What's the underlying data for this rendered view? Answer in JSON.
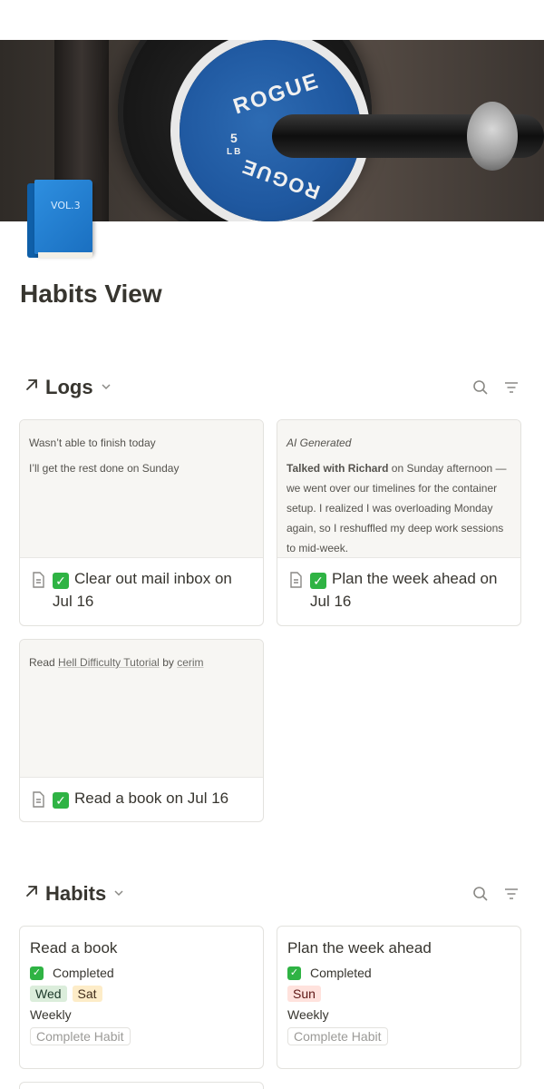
{
  "page": {
    "title": "Habits View"
  },
  "cover": {
    "plate_brand": "ROGUE",
    "plate_weight": "5",
    "plate_unit": "LB"
  },
  "icon": {
    "name": "blue-book-icon",
    "label": "VOL.3"
  },
  "logs": {
    "title": "Logs",
    "cards": [
      {
        "preview_lines": [
          "Wasn’t able to finish today",
          "I’ll get the rest done on Sunday"
        ],
        "label": "Clear out mail inbox on Jul 16"
      },
      {
        "preview_heading": "AI Generated",
        "preview_bold": "Talked with Richard",
        "preview_text": " on Sunday afternoon — we went over our timelines for the container setup. I realized I was overloading Monday again, so I reshuffled my deep work sessions to mid-week.",
        "label": "Plan the week ahead on Jul 16"
      },
      {
        "preview_prefix": "Read ",
        "preview_link1": "Hell Difficulty Tutorial",
        "preview_mid": " by ",
        "preview_link2": "cerim",
        "label": "Read a book on Jul 16"
      }
    ]
  },
  "habits": {
    "title": "Habits",
    "cards": [
      {
        "name": "Read a book",
        "status": "Completed",
        "days": [
          "Wed",
          "Sat"
        ],
        "frequency": "Weekly",
        "button": "Complete Habit"
      },
      {
        "name": "Plan the week ahead",
        "status": "Completed",
        "days": [
          "Sun"
        ],
        "frequency": "Weekly",
        "button": "Complete Habit"
      }
    ]
  },
  "colors": {
    "check_green": "#2fb344",
    "tag_wed": "#dbeddb",
    "tag_sat": "#fdecc8",
    "tag_sun": "#ffe2dd"
  }
}
